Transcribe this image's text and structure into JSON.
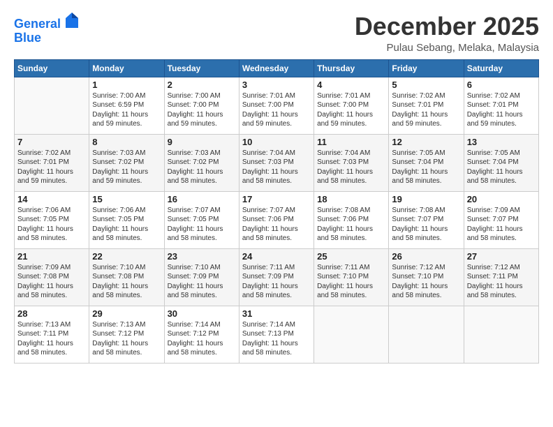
{
  "header": {
    "logo_line1": "General",
    "logo_line2": "Blue",
    "month": "December 2025",
    "location": "Pulau Sebang, Melaka, Malaysia"
  },
  "days_of_week": [
    "Sunday",
    "Monday",
    "Tuesday",
    "Wednesday",
    "Thursday",
    "Friday",
    "Saturday"
  ],
  "weeks": [
    [
      {
        "day": "",
        "info": ""
      },
      {
        "day": "1",
        "info": "Sunrise: 7:00 AM\nSunset: 6:59 PM\nDaylight: 11 hours\nand 59 minutes."
      },
      {
        "day": "2",
        "info": "Sunrise: 7:00 AM\nSunset: 7:00 PM\nDaylight: 11 hours\nand 59 minutes."
      },
      {
        "day": "3",
        "info": "Sunrise: 7:01 AM\nSunset: 7:00 PM\nDaylight: 11 hours\nand 59 minutes."
      },
      {
        "day": "4",
        "info": "Sunrise: 7:01 AM\nSunset: 7:00 PM\nDaylight: 11 hours\nand 59 minutes."
      },
      {
        "day": "5",
        "info": "Sunrise: 7:02 AM\nSunset: 7:01 PM\nDaylight: 11 hours\nand 59 minutes."
      },
      {
        "day": "6",
        "info": "Sunrise: 7:02 AM\nSunset: 7:01 PM\nDaylight: 11 hours\nand 59 minutes."
      }
    ],
    [
      {
        "day": "7",
        "info": "Sunrise: 7:02 AM\nSunset: 7:01 PM\nDaylight: 11 hours\nand 59 minutes."
      },
      {
        "day": "8",
        "info": "Sunrise: 7:03 AM\nSunset: 7:02 PM\nDaylight: 11 hours\nand 59 minutes."
      },
      {
        "day": "9",
        "info": "Sunrise: 7:03 AM\nSunset: 7:02 PM\nDaylight: 11 hours\nand 58 minutes."
      },
      {
        "day": "10",
        "info": "Sunrise: 7:04 AM\nSunset: 7:03 PM\nDaylight: 11 hours\nand 58 minutes."
      },
      {
        "day": "11",
        "info": "Sunrise: 7:04 AM\nSunset: 7:03 PM\nDaylight: 11 hours\nand 58 minutes."
      },
      {
        "day": "12",
        "info": "Sunrise: 7:05 AM\nSunset: 7:04 PM\nDaylight: 11 hours\nand 58 minutes."
      },
      {
        "day": "13",
        "info": "Sunrise: 7:05 AM\nSunset: 7:04 PM\nDaylight: 11 hours\nand 58 minutes."
      }
    ],
    [
      {
        "day": "14",
        "info": "Sunrise: 7:06 AM\nSunset: 7:05 PM\nDaylight: 11 hours\nand 58 minutes."
      },
      {
        "day": "15",
        "info": "Sunrise: 7:06 AM\nSunset: 7:05 PM\nDaylight: 11 hours\nand 58 minutes."
      },
      {
        "day": "16",
        "info": "Sunrise: 7:07 AM\nSunset: 7:05 PM\nDaylight: 11 hours\nand 58 minutes."
      },
      {
        "day": "17",
        "info": "Sunrise: 7:07 AM\nSunset: 7:06 PM\nDaylight: 11 hours\nand 58 minutes."
      },
      {
        "day": "18",
        "info": "Sunrise: 7:08 AM\nSunset: 7:06 PM\nDaylight: 11 hours\nand 58 minutes."
      },
      {
        "day": "19",
        "info": "Sunrise: 7:08 AM\nSunset: 7:07 PM\nDaylight: 11 hours\nand 58 minutes."
      },
      {
        "day": "20",
        "info": "Sunrise: 7:09 AM\nSunset: 7:07 PM\nDaylight: 11 hours\nand 58 minutes."
      }
    ],
    [
      {
        "day": "21",
        "info": "Sunrise: 7:09 AM\nSunset: 7:08 PM\nDaylight: 11 hours\nand 58 minutes."
      },
      {
        "day": "22",
        "info": "Sunrise: 7:10 AM\nSunset: 7:08 PM\nDaylight: 11 hours\nand 58 minutes."
      },
      {
        "day": "23",
        "info": "Sunrise: 7:10 AM\nSunset: 7:09 PM\nDaylight: 11 hours\nand 58 minutes."
      },
      {
        "day": "24",
        "info": "Sunrise: 7:11 AM\nSunset: 7:09 PM\nDaylight: 11 hours\nand 58 minutes."
      },
      {
        "day": "25",
        "info": "Sunrise: 7:11 AM\nSunset: 7:10 PM\nDaylight: 11 hours\nand 58 minutes."
      },
      {
        "day": "26",
        "info": "Sunrise: 7:12 AM\nSunset: 7:10 PM\nDaylight: 11 hours\nand 58 minutes."
      },
      {
        "day": "27",
        "info": "Sunrise: 7:12 AM\nSunset: 7:11 PM\nDaylight: 11 hours\nand 58 minutes."
      }
    ],
    [
      {
        "day": "28",
        "info": "Sunrise: 7:13 AM\nSunset: 7:11 PM\nDaylight: 11 hours\nand 58 minutes."
      },
      {
        "day": "29",
        "info": "Sunrise: 7:13 AM\nSunset: 7:12 PM\nDaylight: 11 hours\nand 58 minutes."
      },
      {
        "day": "30",
        "info": "Sunrise: 7:14 AM\nSunset: 7:12 PM\nDaylight: 11 hours\nand 58 minutes."
      },
      {
        "day": "31",
        "info": "Sunrise: 7:14 AM\nSunset: 7:13 PM\nDaylight: 11 hours\nand 58 minutes."
      },
      {
        "day": "",
        "info": ""
      },
      {
        "day": "",
        "info": ""
      },
      {
        "day": "",
        "info": ""
      }
    ]
  ]
}
